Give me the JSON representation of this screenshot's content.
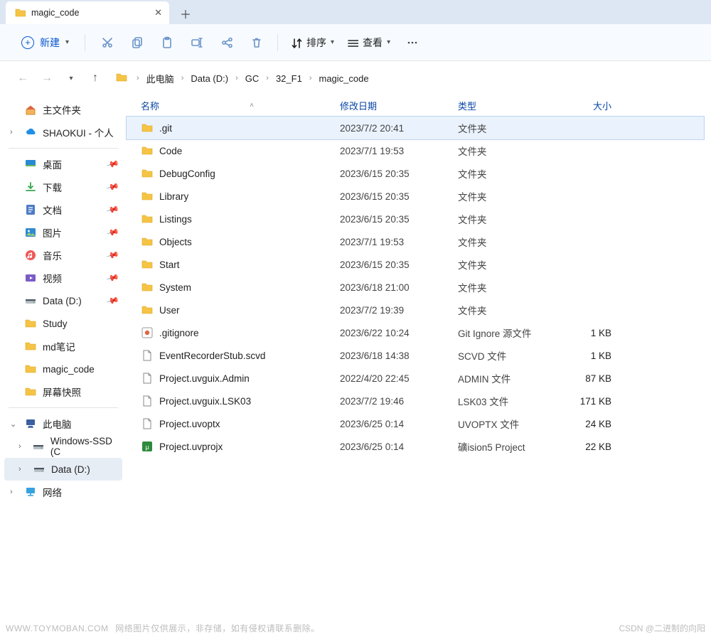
{
  "tab": {
    "title": "magic_code"
  },
  "toolbar": {
    "new_label": "新建",
    "sort_label": "排序",
    "view_label": "查看"
  },
  "breadcrumb": [
    "此电脑",
    "Data (D:)",
    "GC",
    "32_F1",
    "magic_code"
  ],
  "sidebar": {
    "home_label": "主文件夹",
    "cloud_label": "SHAOKUI - 个人",
    "quick": [
      {
        "label": "桌面",
        "icon": "desktop"
      },
      {
        "label": "下载",
        "icon": "download"
      },
      {
        "label": "文档",
        "icon": "doc"
      },
      {
        "label": "图片",
        "icon": "image"
      },
      {
        "label": "音乐",
        "icon": "music"
      },
      {
        "label": "视频",
        "icon": "video"
      },
      {
        "label": "Data (D:)",
        "icon": "drive"
      },
      {
        "label": "Study",
        "icon": "folder"
      },
      {
        "label": "md笔记",
        "icon": "folder"
      },
      {
        "label": "magic_code",
        "icon": "folder"
      },
      {
        "label": "屏幕快照",
        "icon": "folder"
      }
    ],
    "this_pc_label": "此电脑",
    "drives": [
      {
        "label": "Windows-SSD (C"
      },
      {
        "label": "Data (D:)"
      }
    ],
    "network_label": "网络"
  },
  "columns": {
    "name": "名称",
    "date": "修改日期",
    "type": "类型",
    "size": "大小"
  },
  "files": [
    {
      "name": ".git",
      "date": "2023/7/2 20:41",
      "type": "文件夹",
      "size": "",
      "icon": "folder",
      "selected": true
    },
    {
      "name": "Code",
      "date": "2023/7/1 19:53",
      "type": "文件夹",
      "size": "",
      "icon": "folder"
    },
    {
      "name": "DebugConfig",
      "date": "2023/6/15 20:35",
      "type": "文件夹",
      "size": "",
      "icon": "folder"
    },
    {
      "name": "Library",
      "date": "2023/6/15 20:35",
      "type": "文件夹",
      "size": "",
      "icon": "folder"
    },
    {
      "name": "Listings",
      "date": "2023/6/15 20:35",
      "type": "文件夹",
      "size": "",
      "icon": "folder"
    },
    {
      "name": "Objects",
      "date": "2023/7/1 19:53",
      "type": "文件夹",
      "size": "",
      "icon": "folder"
    },
    {
      "name": "Start",
      "date": "2023/6/15 20:35",
      "type": "文件夹",
      "size": "",
      "icon": "folder"
    },
    {
      "name": "System",
      "date": "2023/6/18 21:00",
      "type": "文件夹",
      "size": "",
      "icon": "folder"
    },
    {
      "name": "User",
      "date": "2023/7/2 19:39",
      "type": "文件夹",
      "size": "",
      "icon": "folder"
    },
    {
      "name": ".gitignore",
      "date": "2023/6/22 10:24",
      "type": "Git Ignore 源文件",
      "size": "1 KB",
      "icon": "gitignore"
    },
    {
      "name": "EventRecorderStub.scvd",
      "date": "2023/6/18 14:38",
      "type": "SCVD 文件",
      "size": "1 KB",
      "icon": "file"
    },
    {
      "name": "Project.uvguix.Admin",
      "date": "2022/4/20 22:45",
      "type": "ADMIN 文件",
      "size": "87 KB",
      "icon": "file"
    },
    {
      "name": "Project.uvguix.LSK03",
      "date": "2023/7/2 19:46",
      "type": "LSK03 文件",
      "size": "171 KB",
      "icon": "file"
    },
    {
      "name": "Project.uvoptx",
      "date": "2023/6/25 0:14",
      "type": "UVOPTX 文件",
      "size": "24 KB",
      "icon": "file"
    },
    {
      "name": "Project.uvprojx",
      "date": "2023/6/25 0:14",
      "type": "礦ision5 Project",
      "size": "22 KB",
      "icon": "uvproj"
    }
  ],
  "watermark": {
    "left_domain": "WWW.TOYMOBAN.COM",
    "left_text": "网络图片仅供展示，非存储，如有侵权请联系删除。",
    "right": "CSDN @二进制的向阳"
  }
}
